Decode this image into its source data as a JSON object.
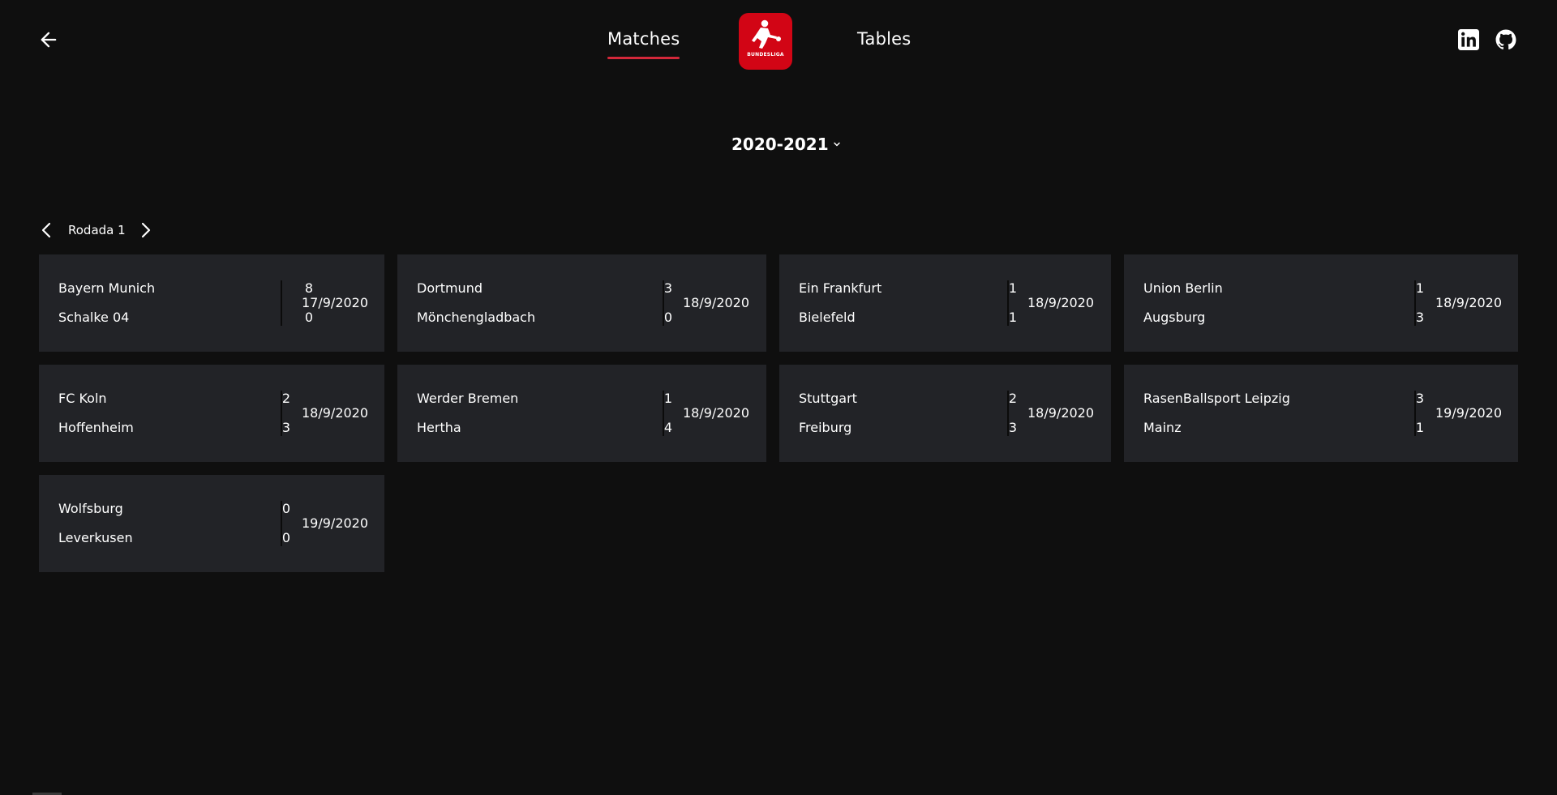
{
  "header": {
    "back_icon": "arrow-left-icon",
    "nav": {
      "matches": "Matches",
      "tables": "Tables"
    },
    "logo_text": "BUNDESLIGA",
    "social": [
      "linkedin-icon",
      "github-icon"
    ]
  },
  "season": {
    "label": "2020-2021"
  },
  "round": {
    "label": "Rodada 1"
  },
  "matches": [
    {
      "home": "Bayern Munich",
      "home_score": "8",
      "away": "Schalke 04",
      "away_score": "0",
      "date": "17/9/2020"
    },
    {
      "home": "Dortmund",
      "home_score": "3",
      "away": "Mönchengladbach",
      "away_score": "0",
      "date": "18/9/2020"
    },
    {
      "home": "Ein Frankfurt",
      "home_score": "1",
      "away": "Bielefeld",
      "away_score": "1",
      "date": "18/9/2020"
    },
    {
      "home": "Union Berlin",
      "home_score": "1",
      "away": "Augsburg",
      "away_score": "3",
      "date": "18/9/2020"
    },
    {
      "home": "FC Koln",
      "home_score": "2",
      "away": "Hoffenheim",
      "away_score": "3",
      "date": "18/9/2020"
    },
    {
      "home": "Werder Bremen",
      "home_score": "1",
      "away": "Hertha",
      "away_score": "4",
      "date": "18/9/2020"
    },
    {
      "home": "Stuttgart",
      "home_score": "2",
      "away": "Freiburg",
      "away_score": "3",
      "date": "18/9/2020"
    },
    {
      "home": "RasenBallsport Leipzig",
      "home_score": "3",
      "away": "Mainz",
      "away_score": "1",
      "date": "19/9/2020"
    },
    {
      "home": "Wolfsburg",
      "home_score": "0",
      "away": "Leverkusen",
      "away_score": "0",
      "date": "19/9/2020"
    }
  ],
  "colors": {
    "background": "#0f0f0f",
    "card": "#222327",
    "accent": "#d3283a",
    "logo": "#d20515"
  }
}
